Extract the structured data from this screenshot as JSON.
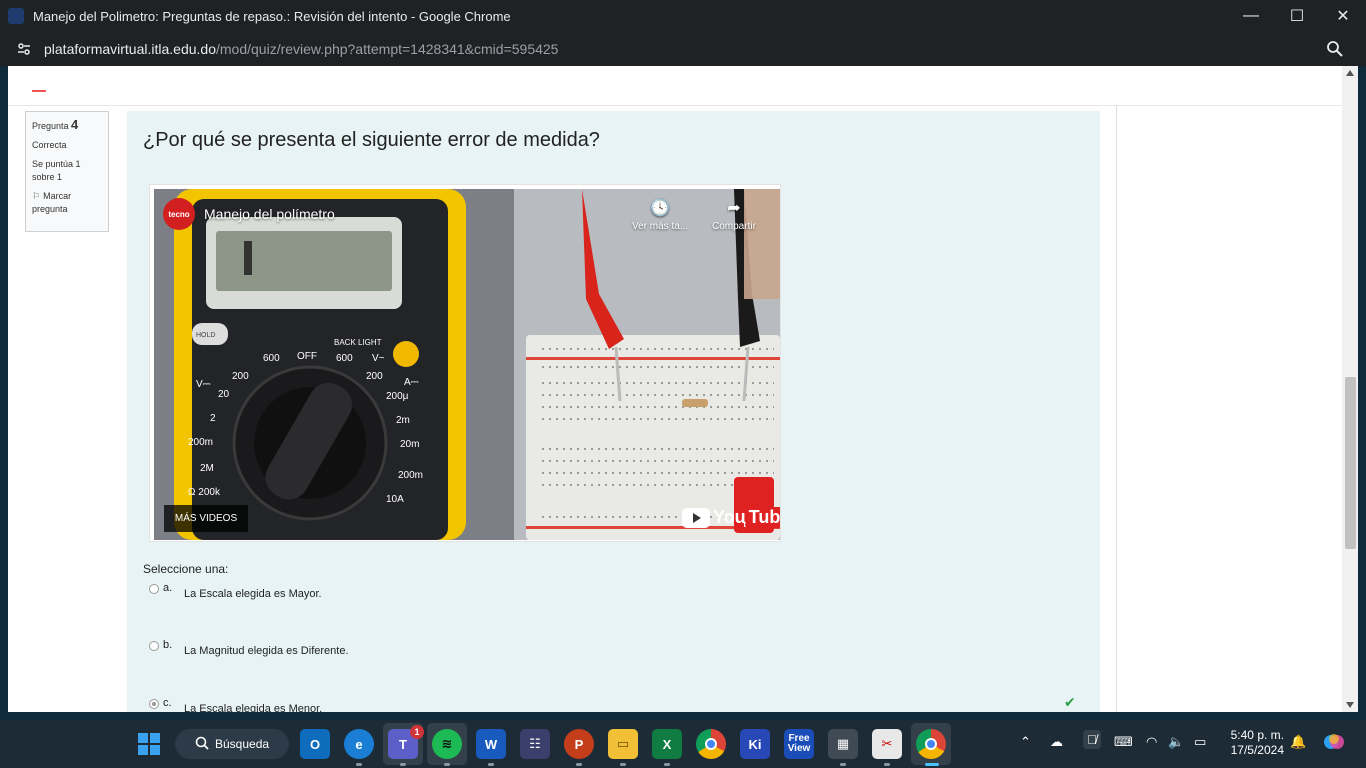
{
  "window": {
    "title": "Manejo del Polimetro: Preguntas de repaso.: Revisión del intento - Google Chrome",
    "minimize": "—",
    "maximize": "☐",
    "close": "✕"
  },
  "address": {
    "host": "plataformavirtual.itla.edu.do",
    "path": "/mod/quiz/review.php?attempt=1428341&cmid=595425"
  },
  "question_info": {
    "label": "Pregunta",
    "number": "4",
    "status": "Correcta",
    "score": "Se puntúa 1 sobre 1",
    "flag_label": "Marcar pregunta"
  },
  "question": {
    "text": "¿Por qué se presenta el siguiente error de medida?",
    "prompt": "Seleccione una:"
  },
  "video": {
    "channel_logo": "tecno",
    "title": "Manejo del polímetro",
    "watch_later": "Ver más ta...",
    "share": "Compartir",
    "more_videos": "MÁS VIDEOS",
    "brand_you": "You",
    "brand_tube": "Tube",
    "badge": "tecno"
  },
  "answers": [
    {
      "letter": "a.",
      "text": "La Escala elegida es Mayor.",
      "checked": false
    },
    {
      "letter": "b.",
      "text": "La Magnitud elegida es Diferente.",
      "checked": false
    },
    {
      "letter": "c.",
      "text": "La Escala elegida es Menor.",
      "checked": true
    }
  ],
  "taskbar": {
    "search_label": "Búsqueda",
    "teams_badge": "1",
    "freeview_label": "Free View",
    "time": "5:40 p. m.",
    "date": "17/5/2024"
  },
  "colors": {
    "question_bg": "#e7f3f5",
    "correct_check": "#2f9e44",
    "taskbar_bg": "#1c2b36"
  }
}
